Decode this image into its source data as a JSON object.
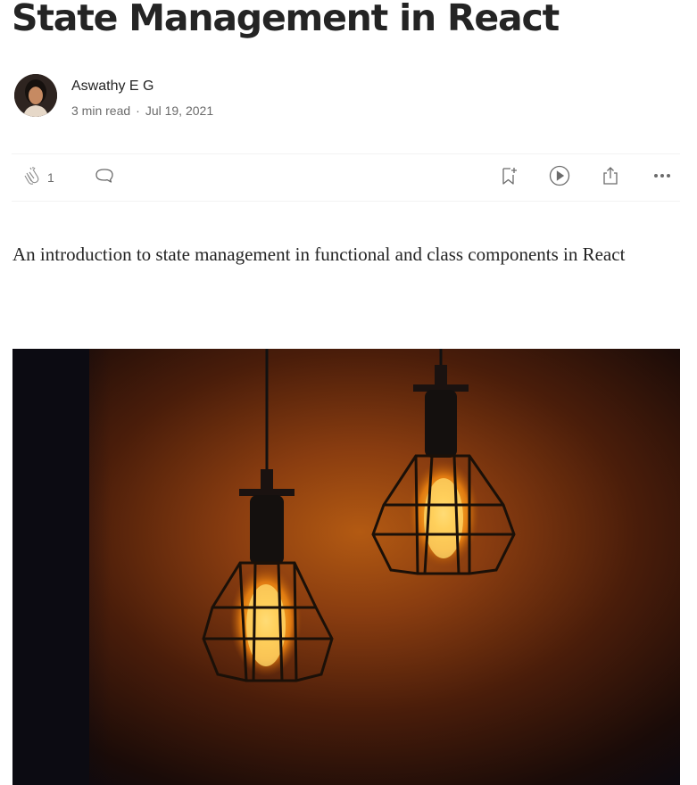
{
  "article": {
    "title": "State Management in React",
    "subtitle": "An introduction to state management in functional and class components in React"
  },
  "author": {
    "name": "Aswathy E G",
    "read_time": "3 min read",
    "separator": "·",
    "date": "Jul 19, 2021"
  },
  "actions": {
    "clap_count": "1",
    "icons": [
      "clap-icon",
      "comment-icon",
      "bookmark-add-icon",
      "play-icon",
      "share-icon",
      "more-icon"
    ]
  },
  "hero_image": {
    "description_icon": "hanging-light-bulbs-image"
  },
  "colors": {
    "text": "#242424",
    "muted": "#6b6b6b",
    "divider": "#f2f2f2"
  }
}
